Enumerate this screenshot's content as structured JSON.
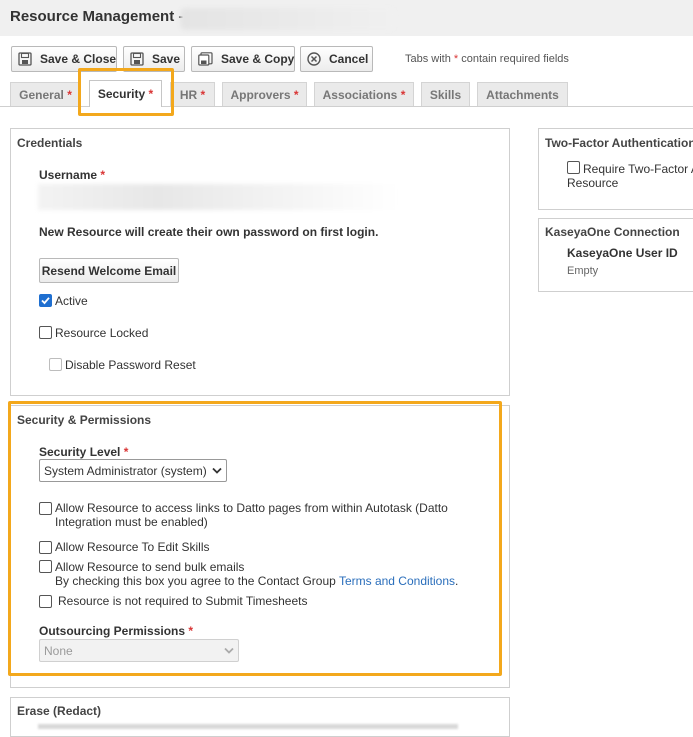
{
  "header": {
    "title": "Resource Management -"
  },
  "toolbar": {
    "save_close": "Save & Close",
    "save": "Save",
    "save_copy": "Save & Copy",
    "cancel": "Cancel",
    "required_note_prefix": "Tabs with",
    "required_star": "*",
    "required_note_suffix": "contain required fields"
  },
  "tabs": [
    {
      "label": "General",
      "required": true
    },
    {
      "label": "Security",
      "required": true,
      "active": true
    },
    {
      "label": "HR",
      "required": true
    },
    {
      "label": "Approvers",
      "required": true
    },
    {
      "label": "Associations",
      "required": true
    },
    {
      "label": "Skills",
      "required": false
    },
    {
      "label": "Attachments",
      "required": false
    }
  ],
  "credentials": {
    "title": "Credentials",
    "username_label": "Username",
    "password_note": "New Resource will create their own password on first login.",
    "resend_button": "Resend Welcome Email",
    "active_label": "Active",
    "active_checked": true,
    "locked_label": "Resource Locked",
    "locked_checked": false,
    "disable_reset_label": "Disable Password Reset",
    "disable_reset_checked": false
  },
  "security": {
    "title": "Security & Permissions",
    "level_label": "Security Level",
    "level_value": "System Administrator (system)",
    "datto_links_line1": "Allow Resource to access links to Datto pages from within Autotask (Datto",
    "datto_links_line2": "Integration must be enabled)",
    "edit_skills": "Allow Resource To Edit Skills",
    "bulk_emails": "Allow Resource to send bulk emails",
    "bulk_note": "By checking this box you agree to the Contact Group",
    "terms_link": "Terms and Conditions",
    "terms_period": ".",
    "timesheets": "Resource is not required to Submit Timesheets",
    "outsourcing_label": "Outsourcing Permissions",
    "outsourcing_value": "None"
  },
  "erase": {
    "title": "Erase (Redact)"
  },
  "two_factor": {
    "title": "Two-Factor Authentication",
    "require_line1": "Require Two-Factor A",
    "require_line2": "Resource"
  },
  "kaseya": {
    "title": "KaseyaOne Connection",
    "user_id_label": "KaseyaOne User ID",
    "user_id_value": "Empty"
  },
  "colors": {
    "highlight": "#f3a81c",
    "required_star": "#d93535",
    "link": "#2a6ebb",
    "checkbox_checked": "#1f6fd0"
  },
  "icons": [
    "save-icon",
    "save-copy-icon",
    "cancel-icon",
    "chevron-down-icon",
    "checkmark-icon"
  ]
}
